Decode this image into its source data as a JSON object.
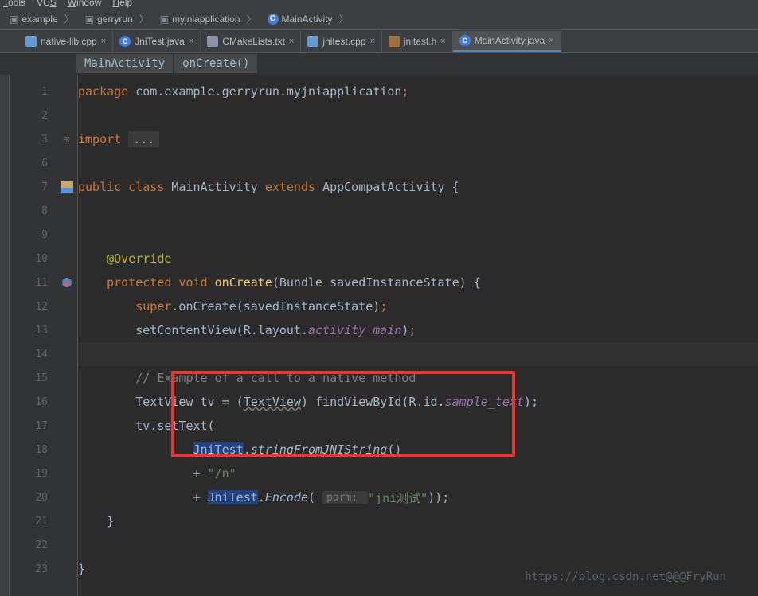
{
  "menu": {
    "items": [
      "Tools",
      "VCS",
      "Window",
      "Help"
    ]
  },
  "breadcrumb": {
    "items": [
      {
        "label": "example",
        "type": "folder"
      },
      {
        "label": "gerryrun",
        "type": "folder"
      },
      {
        "label": "myjniapplication",
        "type": "folder"
      },
      {
        "label": "MainActivity",
        "type": "class"
      }
    ]
  },
  "tabs": [
    {
      "label": "native-lib.cpp",
      "type": "cpp",
      "active": false
    },
    {
      "label": "JniTest.java",
      "type": "java",
      "active": false
    },
    {
      "label": "CMakeLists.txt",
      "type": "txt",
      "active": false
    },
    {
      "label": "jnitest.cpp",
      "type": "cpp",
      "active": false
    },
    {
      "label": "jnitest.h",
      "type": "h",
      "active": false
    },
    {
      "label": "MainActivity.java",
      "type": "java",
      "active": true
    }
  ],
  "editor_breadcrumb": [
    {
      "label": "MainActivity"
    },
    {
      "label": "onCreate()"
    }
  ],
  "line_numbers": [
    "1",
    "2",
    "3",
    "6",
    "7",
    "8",
    "9",
    "10",
    "11",
    "12",
    "13",
    "14",
    "15",
    "16",
    "17",
    "18",
    "19",
    "20",
    "21",
    "22",
    "23"
  ],
  "code": {
    "l1_kw": "package ",
    "l1_path": "com.example.gerryrun.myjniapplication",
    "l1_semi": ";",
    "l3_kw": "import ",
    "l3_ellipsis": "...",
    "l7_public": "public class ",
    "l7_class": "MainActivity ",
    "l7_extends": "extends ",
    "l7_super": "AppCompatActivity ",
    "l7_brace": "{",
    "l10_ann": "@Override",
    "l11_prot": "protected void ",
    "l11_func": "onCreate",
    "l11_sig": "(Bundle savedInstanceState) {",
    "l12_super": "super",
    "l12_call": ".onCreate(savedInstanceState)",
    "l12_semi": ";",
    "l13_set": "setContentView(R.layout.",
    "l13_res": "activity_main",
    "l13_end": ");",
    "l15_comment": "// Example of a call to a native method",
    "l16_a": "TextView tv = (",
    "l16_tv": "TextView",
    "l16_b": ") findViewById(R.id.",
    "l16_res": "sample_text",
    "l16_end": ");",
    "l17_a": "tv.setText(",
    "l18_cls": "JniTest",
    "l18_dot": ".",
    "l18_fn": "stringFromJNIString",
    "l18_par": "()",
    "l19_plus": "+ ",
    "l19_str": "\"/n\"",
    "l20_plus": "+ ",
    "l20_cls": "JniTest",
    "l20_dot": ".",
    "l20_fn": "Encode",
    "l20_p1": "( ",
    "l20_hint": "parm: ",
    "l20_str": "\"jni测试\"",
    "l20_end": "));",
    "l21_brace": "}",
    "l23_brace": "}"
  },
  "watermark": "https://blog.csdn.net@@@FryRun"
}
